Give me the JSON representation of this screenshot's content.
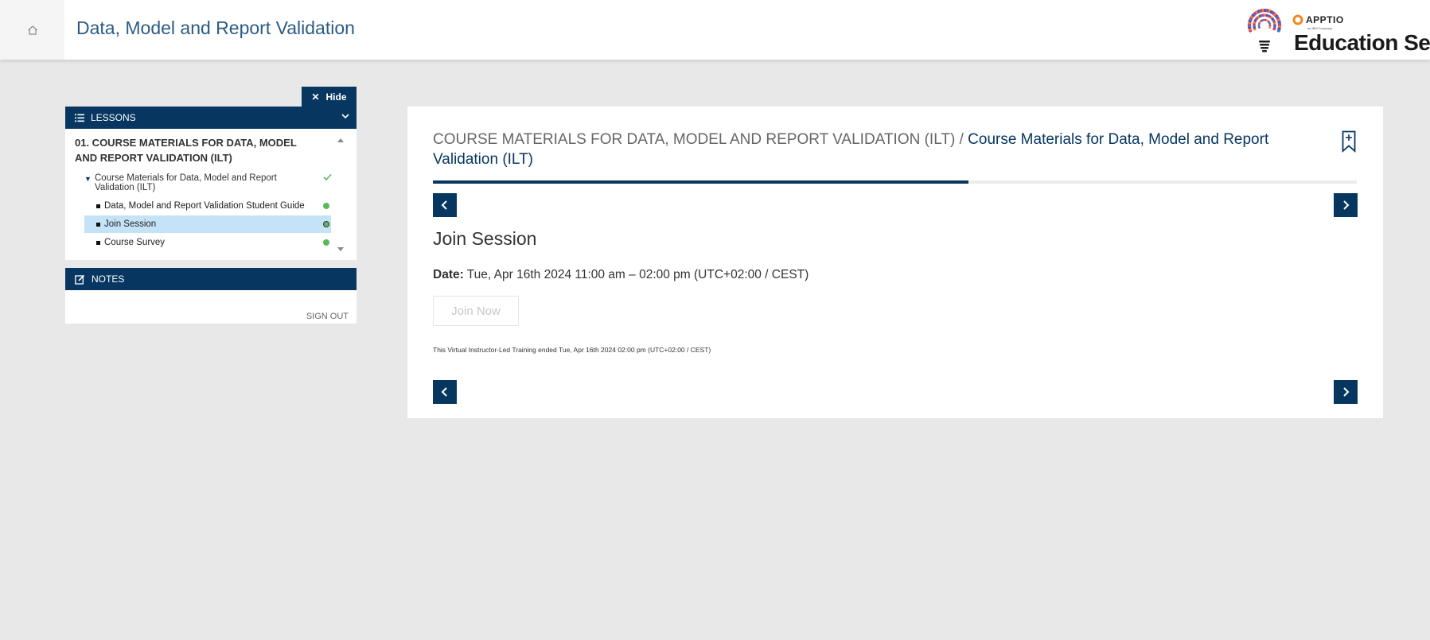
{
  "header": {
    "title": "Data, Model and Report Validation",
    "home_icon": "home-icon"
  },
  "logo": {
    "brand": "APPTIO",
    "sub_brand": "an IBM Company",
    "tagline": "Education Services",
    "colors": [
      "#e4317b",
      "#f08a24",
      "#7b3fa0",
      "#2f7fd0"
    ]
  },
  "sidebar": {
    "hide_label": "Hide",
    "lessons_label": "LESSONS",
    "lesson_title": "01. COURSE MATERIALS FOR DATA, MODEL AND REPORT VALIDATION (ILT)",
    "module": {
      "label": "Course Materials for Data, Model and Report Validation (ILT)",
      "status": "complete"
    },
    "items": [
      {
        "label": "Data, Model and Report Validation Student Guide",
        "status": "complete",
        "active": false
      },
      {
        "label": "Join Session",
        "status": "complete",
        "active": true
      },
      {
        "label": "Course Survey",
        "status": "complete",
        "active": false
      }
    ],
    "notes_label": "NOTES",
    "sign_out": "SIGN OUT"
  },
  "content": {
    "breadcrumb_parent": "COURSE MATERIALS FOR DATA, MODEL AND REPORT VALIDATION (ILT)",
    "breadcrumb_sep": " / ",
    "breadcrumb_current": "Course Materials for Data, Model and Report Validation (ILT)",
    "progress": 0.58,
    "title": "Join Session",
    "date_label": "Date:",
    "date_value": " Tue, Apr 16th 2024 11:00 am – 02:00 pm (UTC+02:00 / CEST)",
    "join_label": "Join Now",
    "ended_note": "This Virtual Instructor-Led Training ended Tue, Apr 16th 2024 02:00 pm (UTC+02:00 / CEST)"
  },
  "colors": {
    "accent": "#073761",
    "title_blue": "#2b5c85",
    "active_row": "#c5e3f7",
    "status_green": "#5cb85c",
    "background": "#e8e8e8"
  }
}
